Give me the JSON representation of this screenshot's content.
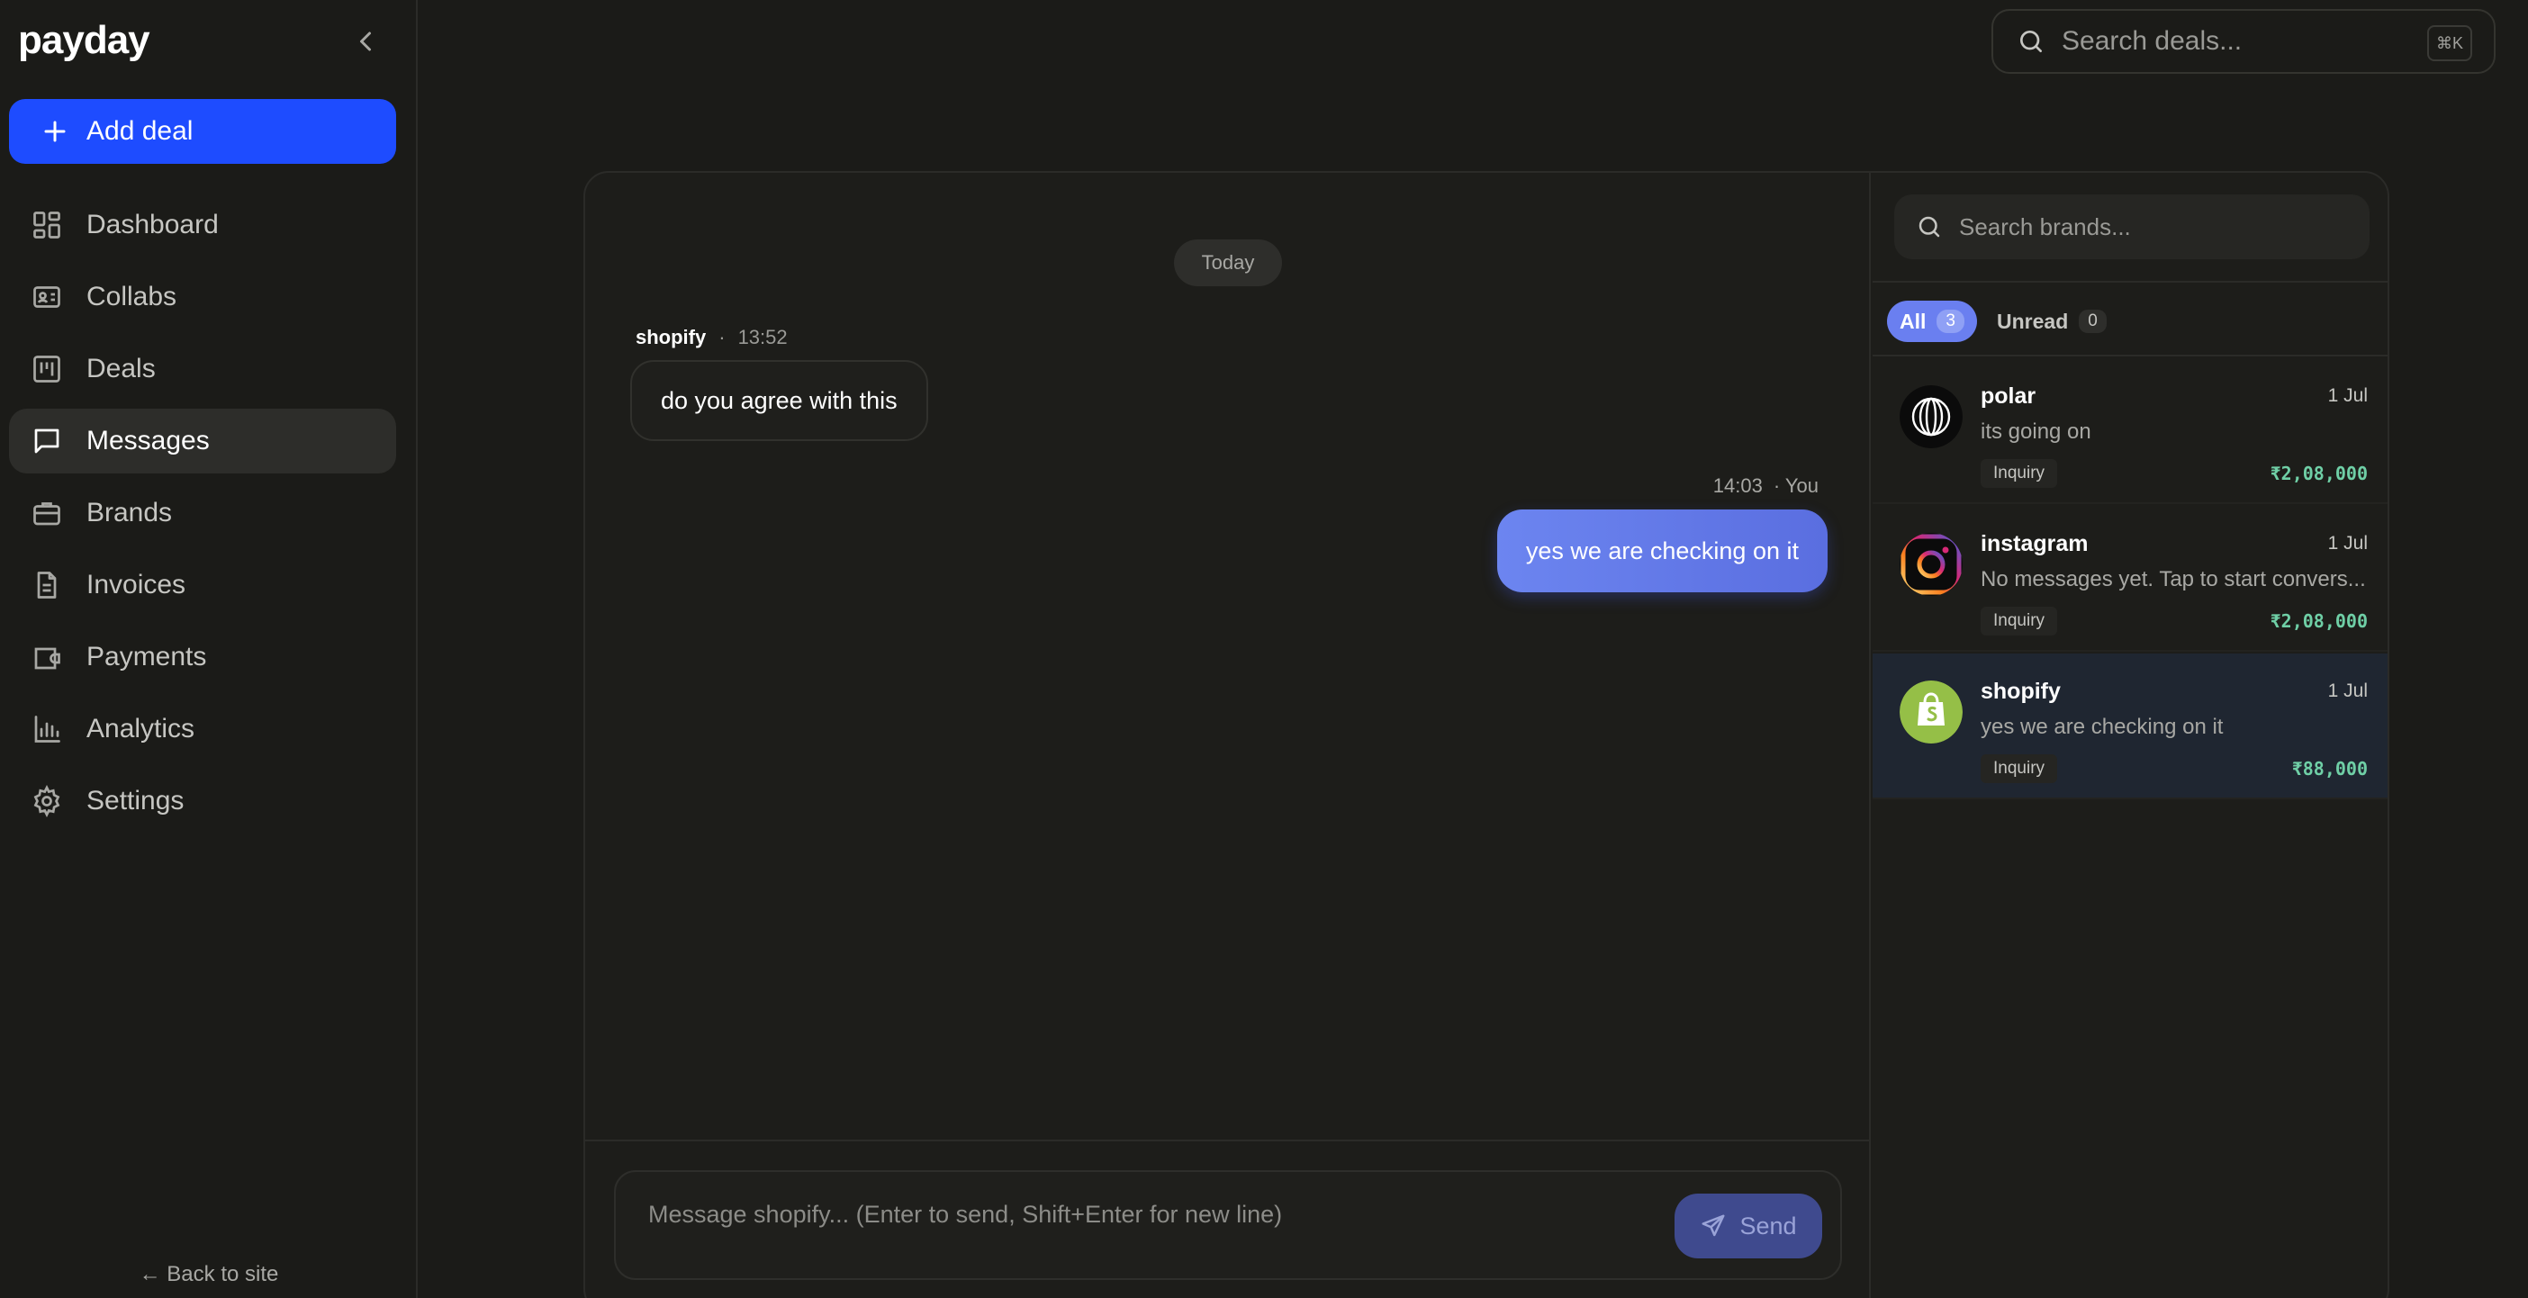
{
  "app": {
    "logo": "payday"
  },
  "sidebar": {
    "add_deal_label": "Add deal",
    "items": [
      {
        "label": "Dashboard",
        "icon": "dashboard-icon"
      },
      {
        "label": "Collabs",
        "icon": "id-card-icon"
      },
      {
        "label": "Deals",
        "icon": "kanban-icon"
      },
      {
        "label": "Messages",
        "icon": "message-icon",
        "active": true
      },
      {
        "label": "Brands",
        "icon": "briefcase-icon"
      },
      {
        "label": "Invoices",
        "icon": "file-icon"
      },
      {
        "label": "Payments",
        "icon": "wallet-icon"
      },
      {
        "label": "Analytics",
        "icon": "bar-chart-icon"
      },
      {
        "label": "Settings",
        "icon": "gear-icon"
      }
    ],
    "back_link": "← Back to site"
  },
  "top_search": {
    "placeholder": "Search deals...",
    "shortcut": "⌘K"
  },
  "chat": {
    "date_divider": "Today",
    "messages": [
      {
        "sender": "shopify",
        "separator": "·",
        "time": "13:52",
        "text": "do you agree with this"
      },
      {
        "time": "14:03",
        "sender": "· You",
        "text": "yes we are checking on it"
      }
    ],
    "composer_placeholder": "Message shopify... (Enter to send, Shift+Enter for new line)",
    "send_label": "Send"
  },
  "brands_panel": {
    "search_placeholder": "Search brands...",
    "tabs": [
      {
        "label": "All",
        "count": "3",
        "active": true
      },
      {
        "label": "Unread",
        "count": "0"
      }
    ],
    "list": [
      {
        "name": "polar",
        "date": "1 Jul",
        "preview": "its going on",
        "status": "Inquiry",
        "amount": "₹2,08,000"
      },
      {
        "name": "instagram",
        "date": "1 Jul",
        "preview": "No messages yet. Tap to start convers...",
        "status": "Inquiry",
        "amount": "₹2,08,000"
      },
      {
        "name": "shopify",
        "date": "1 Jul",
        "preview": "yes we are checking on it",
        "status": "Inquiry",
        "amount": "₹88,000",
        "selected": true
      }
    ]
  },
  "colors": {
    "accent": "#1e4cff",
    "bubble_out": "#6c85f0",
    "amount": "#6fcfa6",
    "background": "#1b1b18"
  }
}
